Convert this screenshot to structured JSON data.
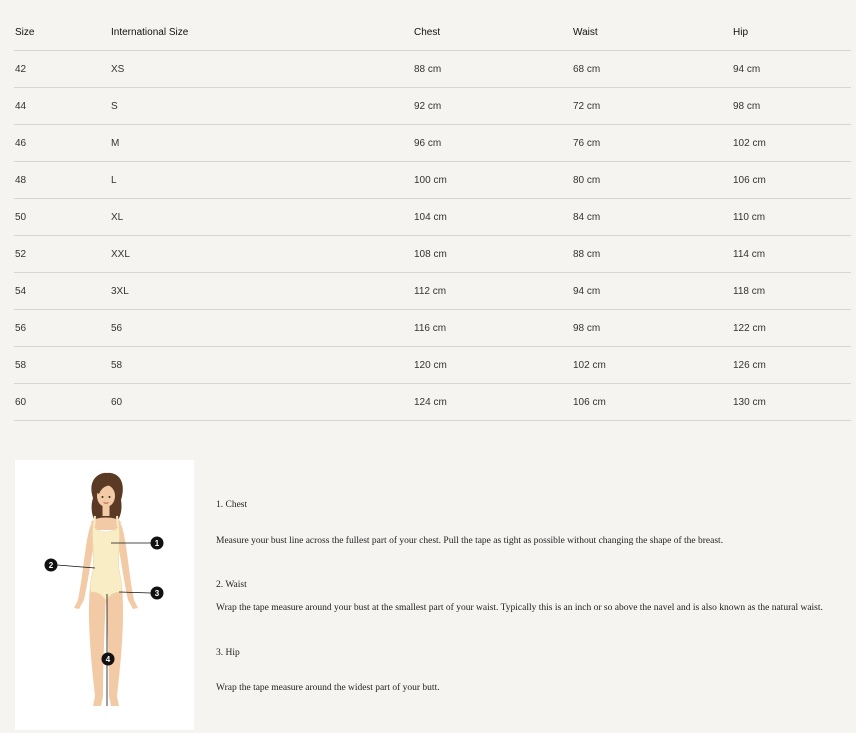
{
  "table": {
    "headers": [
      "Size",
      "International Size",
      "Chest",
      "Waist",
      "Hip"
    ],
    "rows": [
      [
        "42",
        "XS",
        "88 cm",
        "68 cm",
        "94 cm"
      ],
      [
        "44",
        "S",
        "92 cm",
        "72 cm",
        "98 cm"
      ],
      [
        "46",
        "M",
        "96 cm",
        "76 cm",
        "102 cm"
      ],
      [
        "48",
        "L",
        "100 cm",
        "80 cm",
        "106 cm"
      ],
      [
        "50",
        "XL",
        "104 cm",
        "84 cm",
        "110 cm"
      ],
      [
        "52",
        "XXL",
        "108 cm",
        "88 cm",
        "114 cm"
      ],
      [
        "54",
        "3XL",
        "112 cm",
        "94 cm",
        "118 cm"
      ],
      [
        "56",
        "56",
        "116 cm",
        "98 cm",
        "122 cm"
      ],
      [
        "58",
        "58",
        "120 cm",
        "102 cm",
        "126 cm"
      ],
      [
        "60",
        "60",
        "124 cm",
        "106 cm",
        "130 cm"
      ]
    ]
  },
  "figure": {
    "markers": [
      "1",
      "2",
      "3",
      "4"
    ],
    "colors": {
      "skin": "#f2cba6",
      "swimsuit": "#f9edc5",
      "hair": "#5a3a24",
      "marker": "#111111"
    }
  },
  "guide": {
    "chest": {
      "heading": "1. Chest",
      "text": "Measure your bust line across the fullest part of your chest. Pull the tape as tight as possible without changing the shape of the breast."
    },
    "waist": {
      "heading": "2. Waist",
      "text": "Wrap the tape measure around your bust at the smallest part of your waist. Typically this is an inch or so above the navel and is also known as the natural waist."
    },
    "hip": {
      "heading": "3. Hip",
      "text": "Wrap the tape measure around the widest part of your butt."
    }
  }
}
